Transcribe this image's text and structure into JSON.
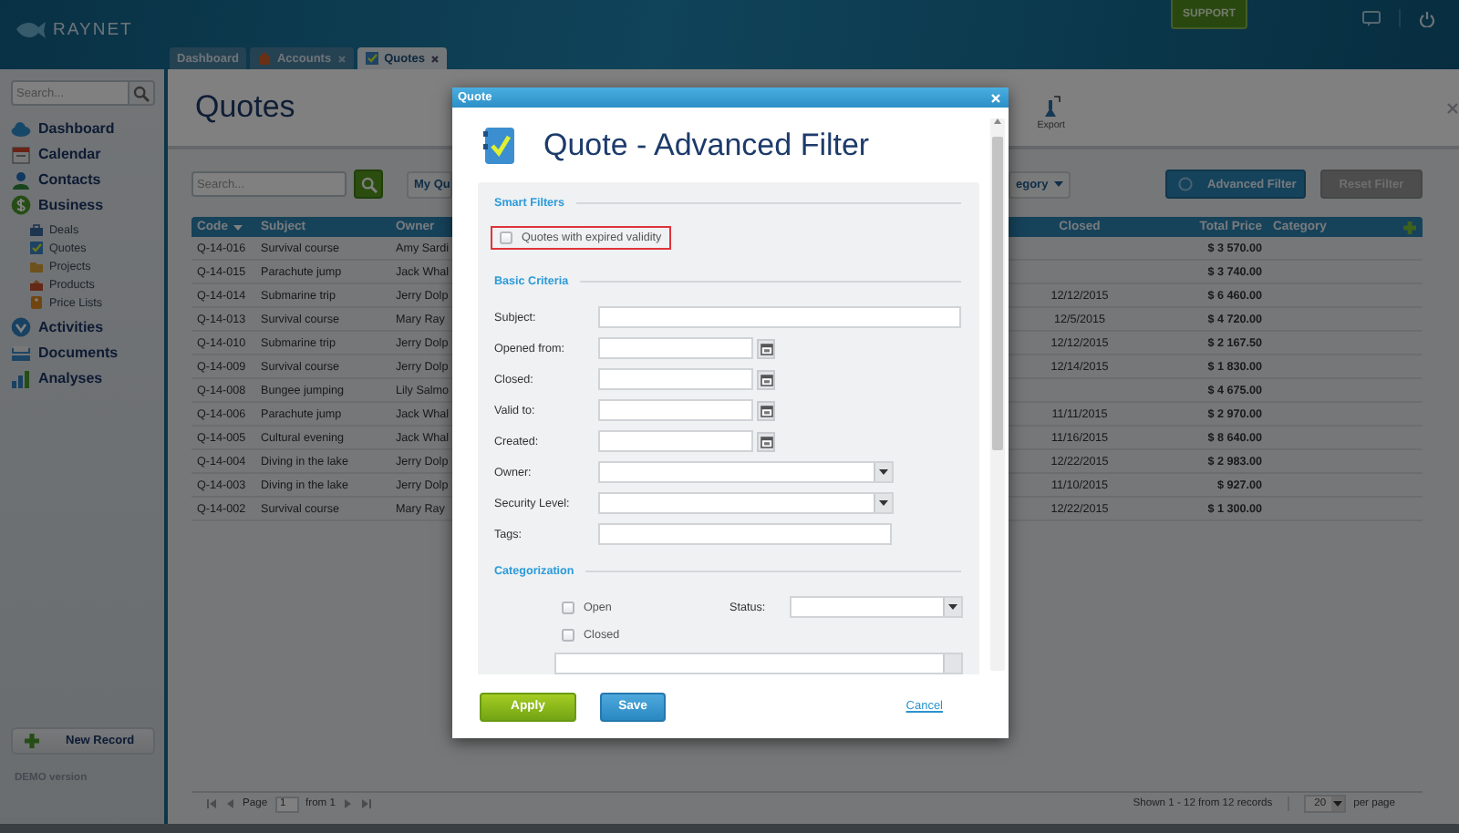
{
  "header": {
    "logo": "RAYNET",
    "tabs": [
      {
        "label": "Dashboard",
        "selected": false,
        "closable": false
      },
      {
        "label": "Accounts",
        "selected": false,
        "closable": true
      },
      {
        "label": "Quotes",
        "selected": true,
        "closable": true
      }
    ],
    "support": "SUPPORT"
  },
  "sidebar": {
    "search_placeholder": "Search...",
    "items": [
      {
        "label": "Dashboard"
      },
      {
        "label": "Calendar"
      },
      {
        "label": "Contacts"
      },
      {
        "label": "Business",
        "children": [
          {
            "label": "Deals"
          },
          {
            "label": "Quotes"
          },
          {
            "label": "Projects"
          },
          {
            "label": "Products"
          },
          {
            "label": "Price Lists"
          }
        ]
      },
      {
        "label": "Activities"
      },
      {
        "label": "Documents"
      },
      {
        "label": "Analyses"
      }
    ],
    "new_record": "New Record",
    "footer": "DEMO version"
  },
  "main": {
    "title": "Quotes",
    "toolbar": [
      {
        "label": "Export"
      }
    ],
    "search_placeholder": "Search...",
    "filter_buttons": [
      "My Qu",
      "egory"
    ],
    "advanced_filter": {
      "label": "Advanced Filter",
      "disabled": false
    },
    "reset_filter": {
      "label": "Reset Filter",
      "disabled": true
    },
    "table": {
      "columns": [
        "Code",
        "Subject",
        "Owner",
        "Closed",
        "Total Price",
        "Category"
      ],
      "rows": [
        {
          "code": "Q-14-016",
          "subject": "Survival course",
          "owner": "Amy Sardi",
          "total_price": "$ 3 570.00"
        },
        {
          "code": "Q-14-015",
          "subject": "Parachute jump",
          "owner": "Jack Whal",
          "total_price": "$ 3 740.00"
        },
        {
          "code": "Q-14-014",
          "subject": "Submarine trip",
          "owner": "Jerry Dolp",
          "closed": "12/12/2015",
          "total_price": "$ 6 460.00"
        },
        {
          "code": "Q-14-013",
          "subject": "Survival course",
          "owner": "Mary Ray",
          "closed": "12/5/2015",
          "total_price": "$ 4 720.00"
        },
        {
          "code": "Q-14-010",
          "subject": "Submarine trip",
          "owner": "Jerry Dolp",
          "closed": "12/12/2015",
          "total_price": "$ 2 167.50"
        },
        {
          "code": "Q-14-009",
          "subject": "Survival course",
          "owner": "Jerry Dolp",
          "closed": "12/14/2015",
          "total_price": "$ 1 830.00"
        },
        {
          "code": "Q-14-008",
          "subject": "Bungee jumping",
          "owner": "Lily Salmo",
          "total_price": "$ 4 675.00"
        },
        {
          "code": "Q-14-006",
          "subject": "Parachute jump",
          "owner": "Jack Whal",
          "closed": "11/11/2015",
          "total_price": "$ 2 970.00"
        },
        {
          "code": "Q-14-005",
          "subject": "Cultural evening",
          "owner": "Jack Whal",
          "closed": "11/16/2015",
          "total_price": "$ 8 640.00"
        },
        {
          "code": "Q-14-004",
          "subject": "Diving in the lake",
          "owner": "Jerry Dolp",
          "closed": "12/22/2015",
          "total_price": "$ 2 983.00"
        },
        {
          "code": "Q-14-003",
          "subject": "Diving in the lake",
          "owner": "Jerry Dolp",
          "closed": "11/10/2015",
          "total_price": "$ 927.00"
        },
        {
          "code": "Q-14-002",
          "subject": "Survival course",
          "owner": "Mary Ray",
          "closed": "12/22/2015",
          "total_price": "$ 1 300.00"
        }
      ]
    },
    "pager": {
      "page_label": "Page",
      "page": "1",
      "of": "from 1",
      "summary": "Shown 1 - 12 from 12 records",
      "per_page": "20",
      "per_page_label": "per page"
    }
  },
  "dialog": {
    "title": "Quote",
    "heading": "Quote - Advanced Filter",
    "smart_filters": {
      "title": "Smart Filters",
      "options": [
        {
          "label": "Quotes with expired validity",
          "checked": false,
          "highlighted": true
        }
      ]
    },
    "basic_criteria": {
      "title": "Basic Criteria",
      "fields": [
        {
          "label": "Subject:",
          "kind": "text"
        },
        {
          "label": "Opened from:",
          "kind": "date"
        },
        {
          "label": "Closed:",
          "kind": "date"
        },
        {
          "label": "Valid to:",
          "kind": "date"
        },
        {
          "label": "Created:",
          "kind": "date"
        },
        {
          "label": "Owner:",
          "kind": "select"
        },
        {
          "label": "Security Level:",
          "kind": "select"
        },
        {
          "label": "Tags:",
          "kind": "tags"
        }
      ]
    },
    "categorization": {
      "title": "Categorization",
      "options": [
        {
          "label": "Open",
          "checked": false
        },
        {
          "label": "Closed",
          "checked": false
        }
      ],
      "status_label": "Status:"
    },
    "apply": "Apply",
    "save": "Save",
    "cancel": "Cancel"
  }
}
